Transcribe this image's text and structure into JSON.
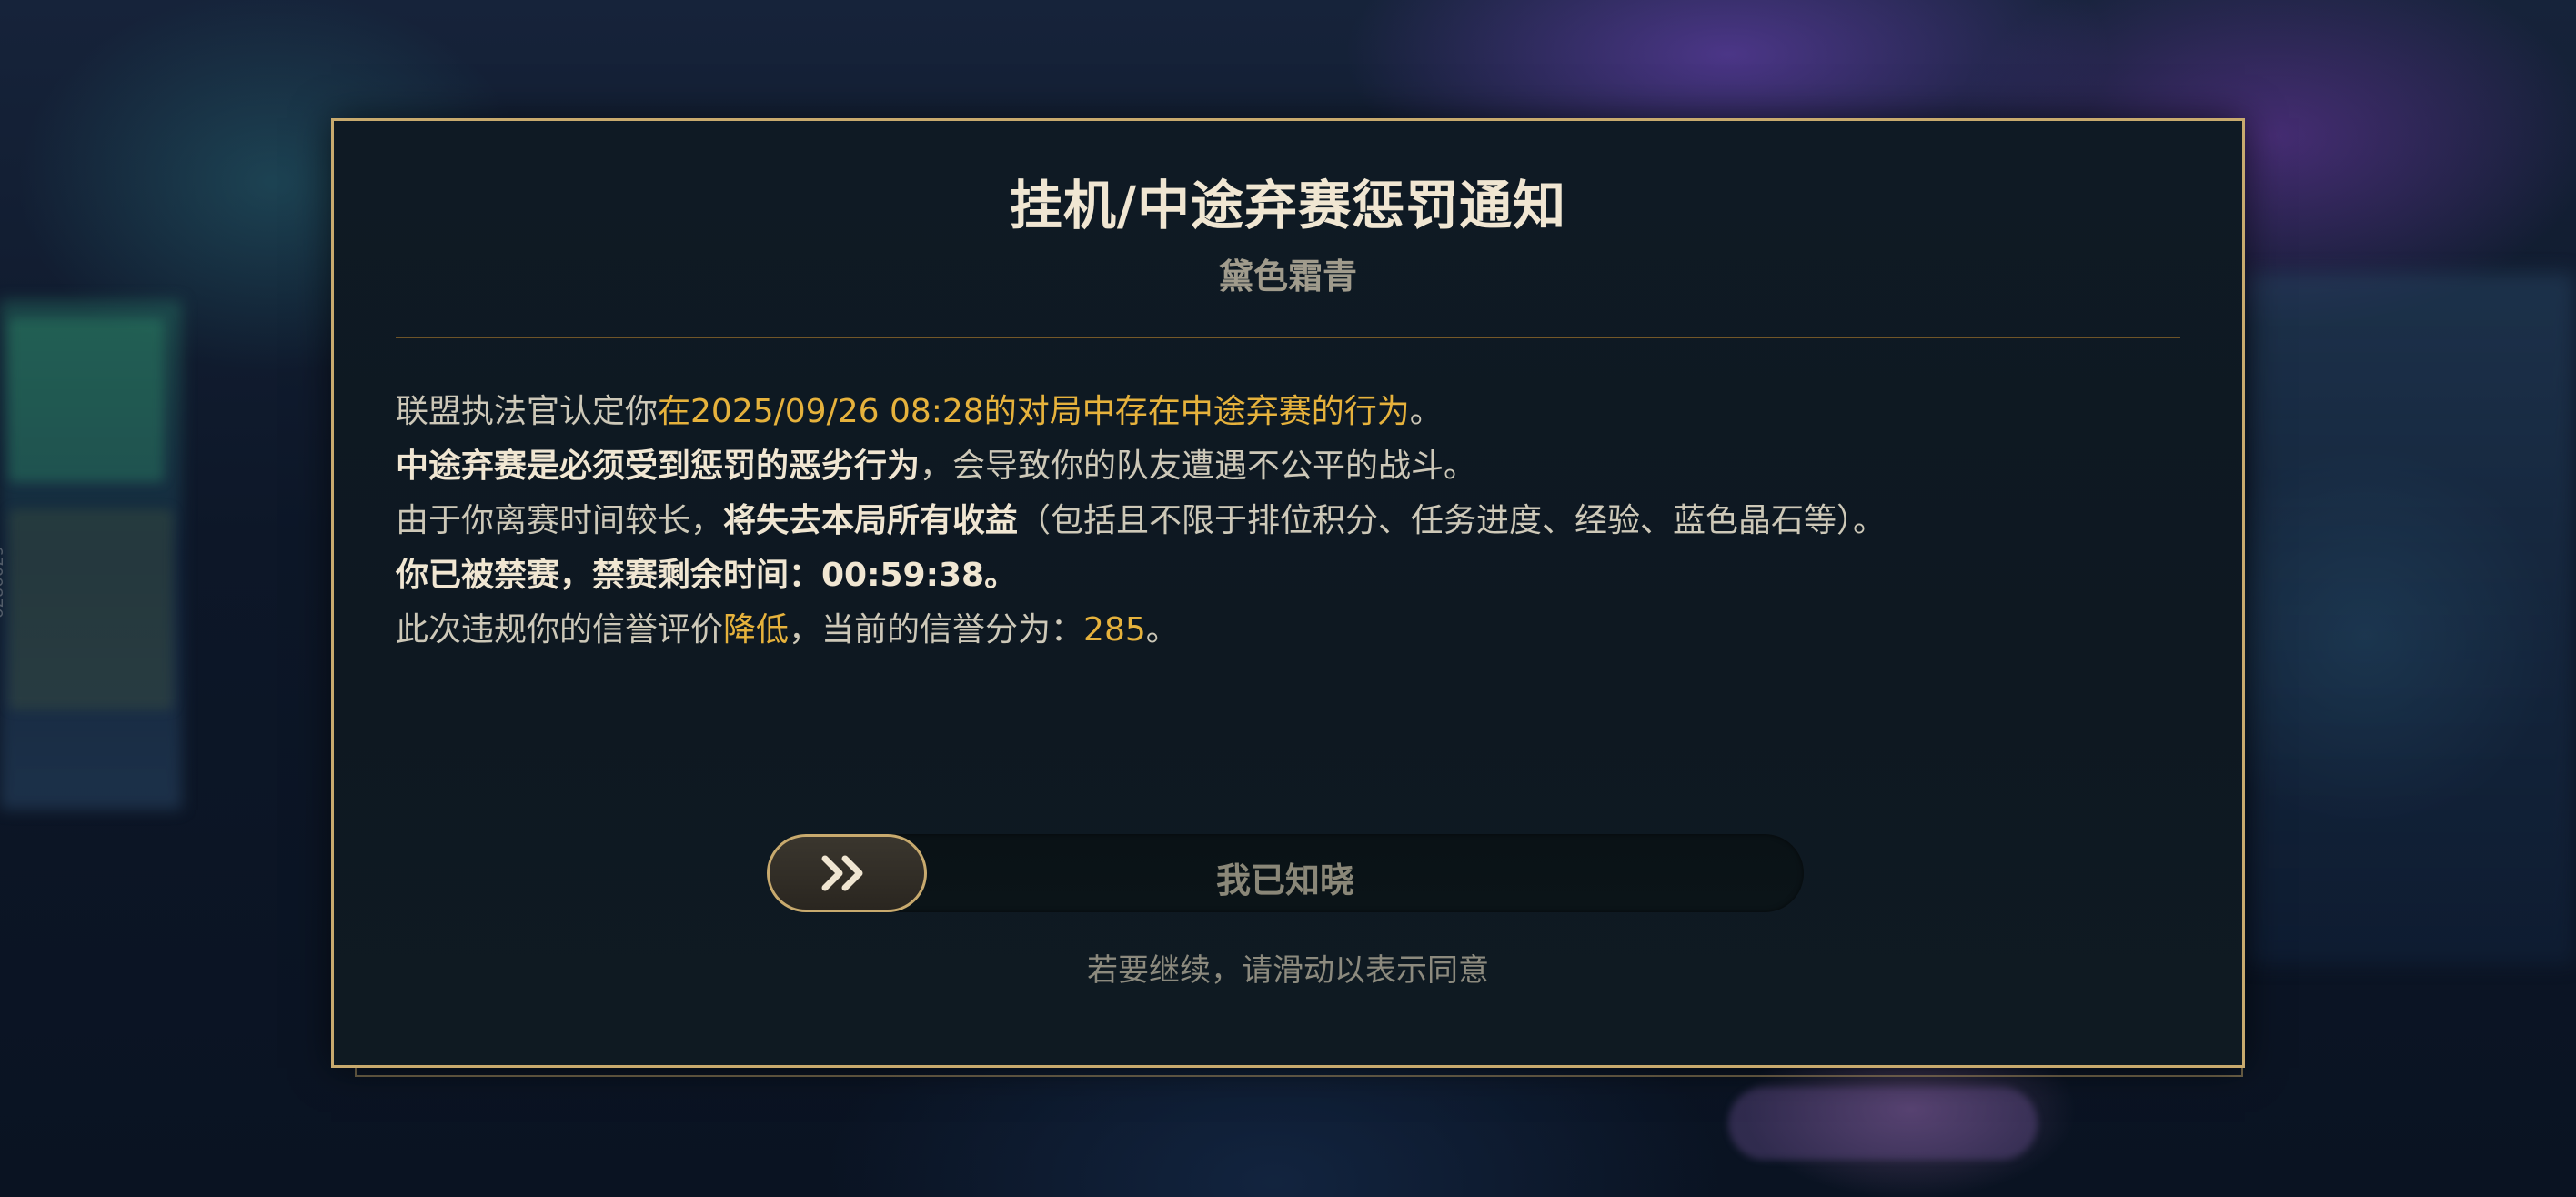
{
  "background": {
    "side_id": "6709879"
  },
  "dialog": {
    "title": "挂机/中途弃赛惩罚通知",
    "subtitle": "黛色霜青",
    "line1": {
      "prefix": "联盟执法官认定你",
      "highlight": "在2025/09/26 08:28的对局中存在中途弃赛的行为",
      "suffix": "。"
    },
    "line2": {
      "strong": "中途弃赛是必须受到惩罚的恶劣行为",
      "suffix": "，会导致你的队友遭遇不公平的战斗。"
    },
    "line3": {
      "prefix": "由于你离赛时间较长，",
      "strong": "将失去本局所有收益",
      "suffix": "（包括且不限于排位积分、任务进度、经验、蓝色晶石等）。"
    },
    "line4": {
      "strong": "你已被禁赛，禁赛剩余时间：00:59:38。"
    },
    "line5": {
      "prefix": "此次违规你的信誉评价",
      "highlight": "降低",
      "middle": "，当前的信誉分为：",
      "score": "285",
      "suffix": "。"
    },
    "slider_label": "我已知晓",
    "hint": "若要继续，请滑动以表示同意"
  },
  "colors": {
    "gold_border": "#c8aa6e",
    "highlight": "#e6b23c",
    "title": "#f0e6d2",
    "body_text": "#cdc8b8"
  },
  "icons": {
    "slider_knob": "double-chevron-right-icon"
  }
}
